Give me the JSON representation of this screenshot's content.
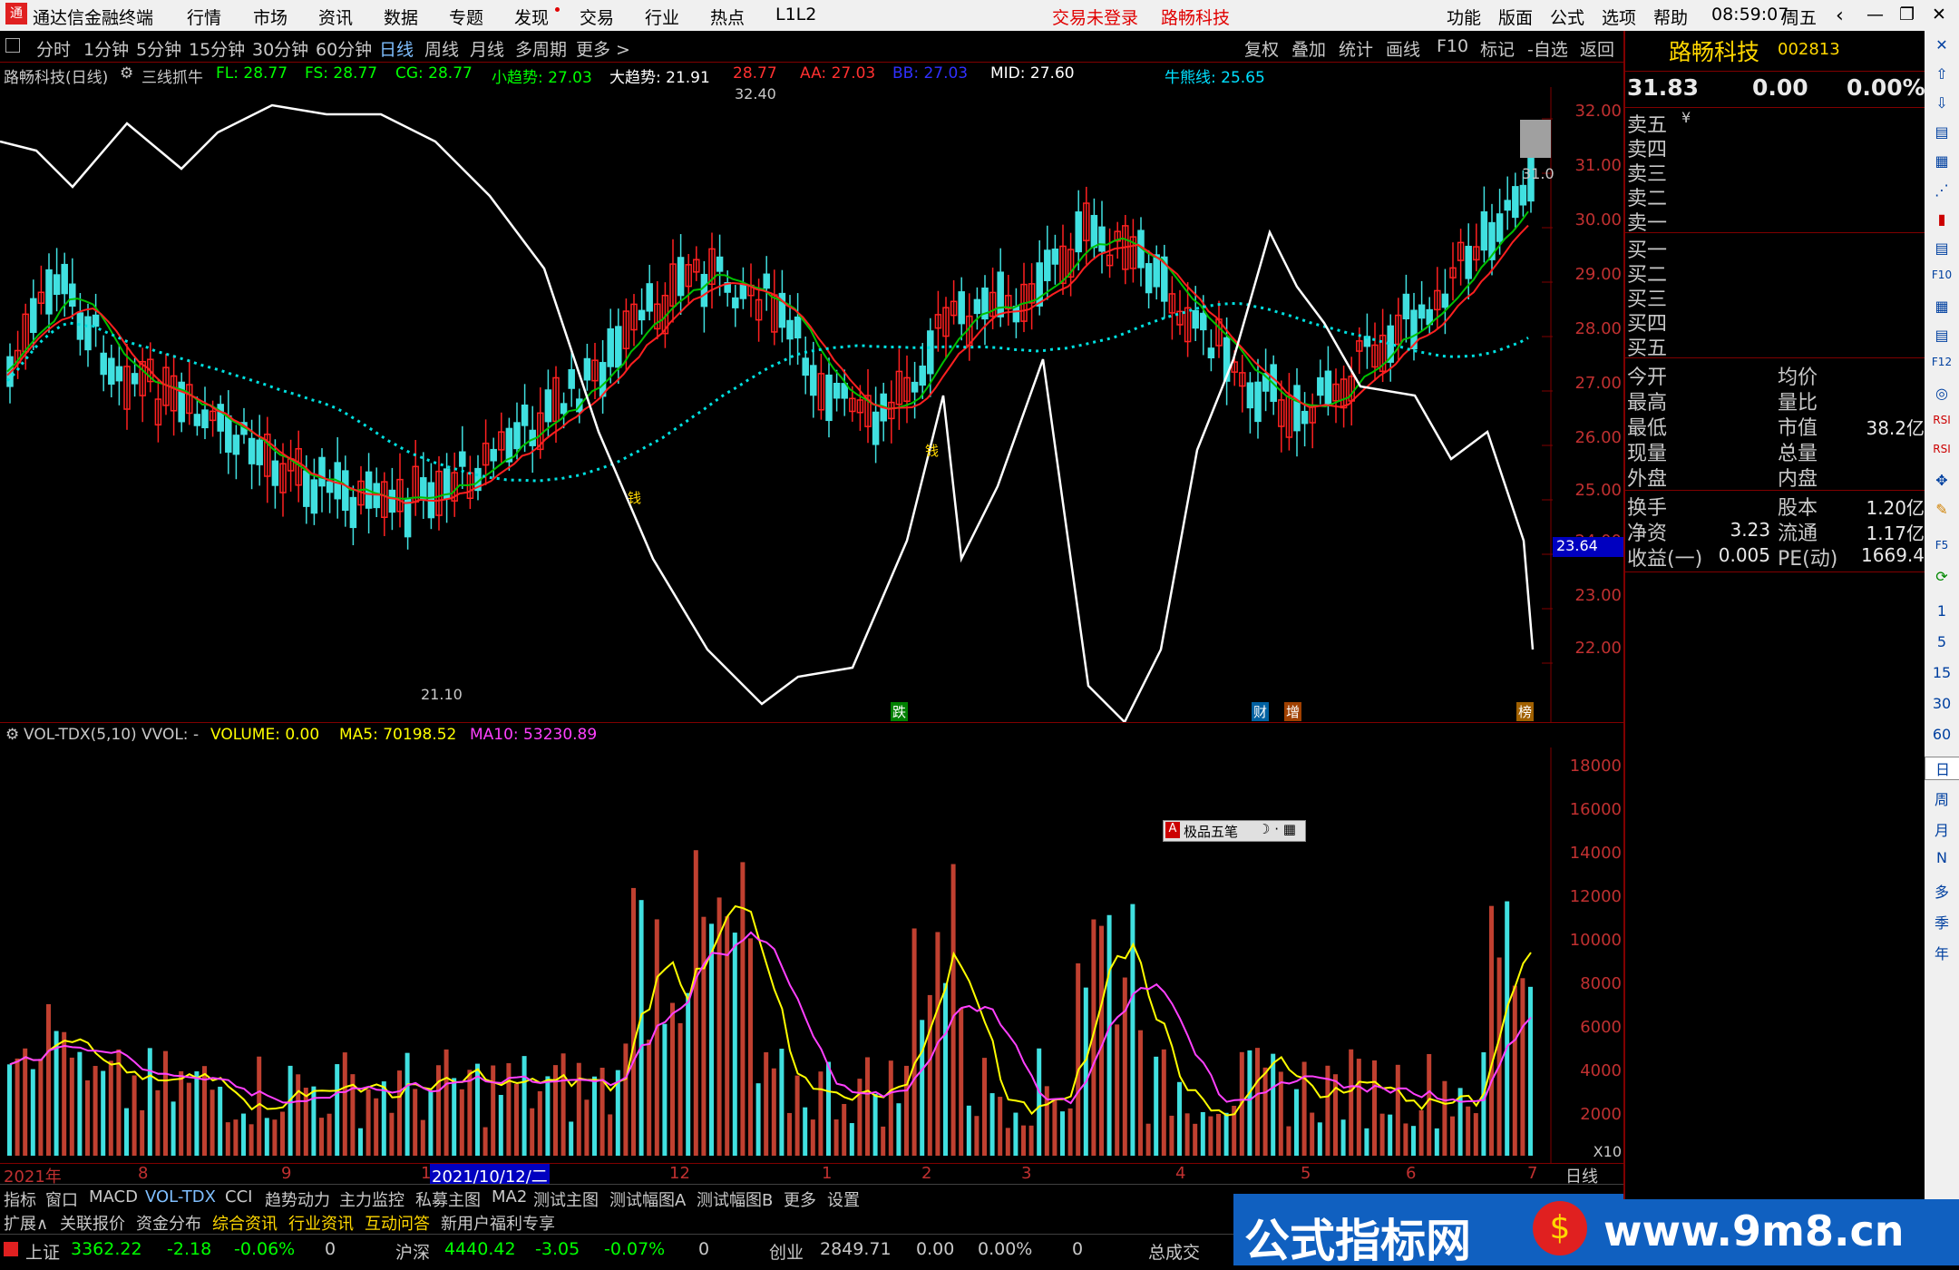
{
  "titlebar": {
    "app_title": "通达信金融终端",
    "menus": [
      "行情",
      "市场",
      "资讯",
      "数据",
      "专题",
      "发现",
      "交易",
      "行业",
      "热点",
      "L1L2"
    ],
    "login_status": "交易未登录",
    "stock_name": "路畅科技",
    "right_menus": [
      "功能",
      "版面",
      "公式",
      "选项",
      "帮助"
    ],
    "time": "08:59:07",
    "weekday": "周五"
  },
  "toolbar": {
    "periods": [
      "分时",
      "1分钟",
      "5分钟",
      "15分钟",
      "30分钟",
      "60分钟",
      "日线",
      "周线",
      "月线",
      "多周期",
      "更多 >"
    ],
    "active_period": "日线",
    "actions": [
      "复权",
      "叠加",
      "统计",
      "画线",
      "F10",
      "标记",
      "-自选",
      "返回"
    ]
  },
  "main_chart": {
    "title": "路畅科技(日线)",
    "indicator_name": "三线抓牛",
    "values": [
      {
        "label": "FL: 28.77",
        "color": "#00ff00"
      },
      {
        "label": "FS: 28.77",
        "color": "#00ff00"
      },
      {
        "label": "CG: 28.77",
        "color": "#00ff00"
      },
      {
        "label": "小趋势: 27.03",
        "color": "#00ff00"
      },
      {
        "label": "大趋势: 21.91",
        "color": "#ffffff"
      },
      {
        "label": "28.77",
        "color": "#ff3030"
      },
      {
        "label": "AA: 27.03",
        "color": "#ff3030"
      },
      {
        "label": "BB: 27.03",
        "color": "#3030ff"
      },
      {
        "label": "MID: 27.60",
        "color": "#ffffff"
      },
      {
        "label": "牛熊线: 25.65",
        "color": "#00e0ff"
      }
    ],
    "price_axis": [
      "32.00",
      "31.00",
      "30.00",
      "29.00",
      "28.00",
      "27.00",
      "26.00",
      "25.00",
      "24.00",
      "23.00",
      "22.00"
    ],
    "high_mark": "32.40",
    "low_mark": "21.10",
    "current_tag": "31.0",
    "level_tag": "23.64",
    "markers": [
      "跌",
      "财",
      "增",
      "榜",
      "钱",
      "钱"
    ]
  },
  "volume_chart": {
    "title": "VOL-TDX(5,10)",
    "vvol": "VVOL: -",
    "volume": "VOLUME: 0.00",
    "ma5": "MA5: 70198.52",
    "ma10": "MA10: 53230.89",
    "axis": [
      "18000",
      "16000",
      "14000",
      "12000",
      "10000",
      "8000",
      "6000",
      "4000",
      "2000"
    ],
    "unit": "X10",
    "input_method": "极品五笔"
  },
  "date_axis": {
    "labels": [
      "2021年",
      "8",
      "9",
      "10",
      "2021/10/12/二",
      "12",
      "1",
      "2",
      "3",
      "4",
      "5",
      "6",
      "7"
    ],
    "period": "日线"
  },
  "tabs_row1": [
    "指标",
    "窗口",
    "MACD",
    "VOL-TDX",
    "CCI",
    "趋势动力",
    "主力监控",
    "私募主图",
    "MA2",
    "测试主图",
    "测试幅图A",
    "测试幅图B",
    "更多",
    "设置"
  ],
  "tabs_row2": [
    "扩展∧",
    "关联报价",
    "资金分布",
    "综合资讯",
    "行业资讯",
    "互动问答",
    "新用户福利专享"
  ],
  "quote_panel": {
    "name": "路畅科技",
    "code": "002813",
    "price": "31.83",
    "change": "0.00",
    "pct": "0.00%",
    "sell": [
      "卖五",
      "卖四",
      "卖三",
      "卖二",
      "卖一"
    ],
    "buy": [
      "买一",
      "买二",
      "买三",
      "买四",
      "买五"
    ],
    "stats": [
      {
        "l1": "今开",
        "v1": "",
        "l2": "均价",
        "v2": ""
      },
      {
        "l1": "最高",
        "v1": "",
        "l2": "量比",
        "v2": ""
      },
      {
        "l1": "最低",
        "v1": "",
        "l2": "市值",
        "v2": "38.2亿"
      },
      {
        "l1": "现量",
        "v1": "",
        "l2": "总量",
        "v2": ""
      },
      {
        "l1": "外盘",
        "v1": "",
        "l2": "内盘",
        "v2": ""
      }
    ],
    "stats2": [
      {
        "l1": "换手",
        "v1": "",
        "l2": "股本",
        "v2": "1.20亿"
      },
      {
        "l1": "净资",
        "v1": "3.23",
        "l2": "流通",
        "v2": "1.17亿"
      },
      {
        "l1": "收益(一)",
        "v1": "0.005",
        "l2": "PE(动)",
        "v2": "1669.4"
      }
    ]
  },
  "sidebar": [
    "1",
    "5",
    "15",
    "30",
    "60",
    "日",
    "周",
    "月",
    "N",
    "多",
    "季",
    "年"
  ],
  "status_bar": {
    "sh_name": "上证",
    "sh_val": "3362.22",
    "sh_chg": "-2.18",
    "sh_pct": "-0.06%",
    "sh_vol": "0",
    "hs_name": "沪深",
    "hs_val": "4440.42",
    "hs_chg": "-3.05",
    "hs_pct": "-0.07%",
    "hs_vol": "0",
    "cy_name": "创业",
    "cy_val": "2849.71",
    "cy_chg": "0.00",
    "cy_pct": "0.00%",
    "cy_vol": "0",
    "total": "总成交"
  },
  "banner": {
    "text": "公式指标网",
    "url": "www.9m8.cn"
  },
  "colors": {
    "up": "#ff2020",
    "down": "#40e0e0",
    "line": "#ffffff",
    "accent": "#800000"
  }
}
